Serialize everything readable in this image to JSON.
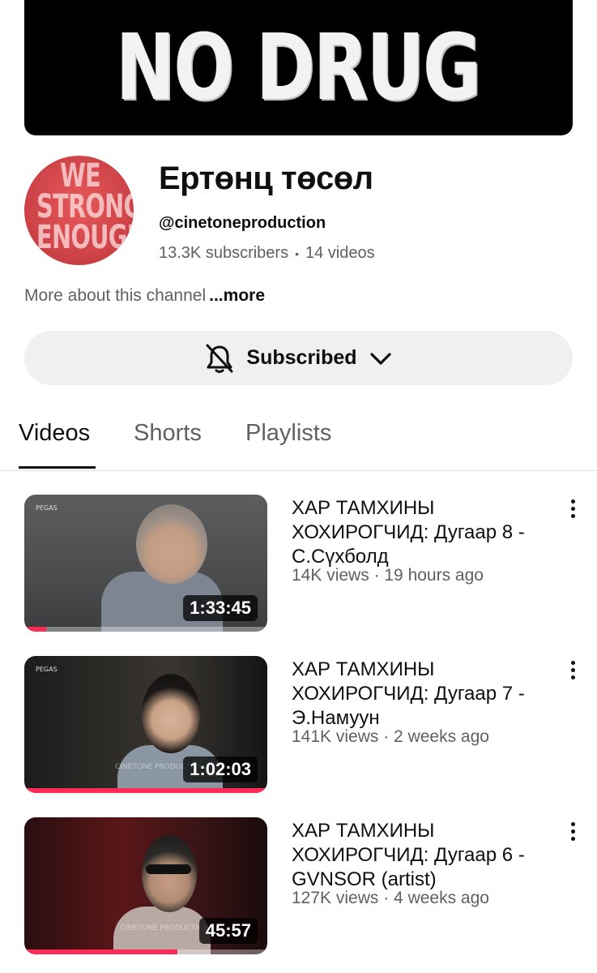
{
  "banner": {
    "text": "NO DRUG"
  },
  "channel": {
    "name": "Ертөнц төсөл",
    "handle": "@cinetoneproduction",
    "subscribers": "13.3K subscribers",
    "videos_count": "14 videos",
    "about": "More about this channel",
    "about_more": "...more",
    "avatar_text": [
      "WE",
      "STRONG",
      "ENOUGH"
    ]
  },
  "subscribe": {
    "label": "Subscribed"
  },
  "tabs": [
    {
      "label": "Videos",
      "active": true
    },
    {
      "label": "Shorts",
      "active": false
    },
    {
      "label": "Playlists",
      "active": false
    }
  ],
  "videos": [
    {
      "title": "ХАР ТАМХИНЫ ХОХИРОГЧИД: Дугаар 8 - С.Сүхболд",
      "meta": "14K views · 19 hours ago",
      "duration": "1:33:45",
      "watched_fraction": 0.09,
      "thumb_label": "PEGAS"
    },
    {
      "title": "ХАР ТАМХИНЫ ХОХИРОГЧИД: Дугаар 7 - Э.Намуун",
      "meta": "141K views · 2 weeks ago",
      "duration": "1:02:03",
      "watched_fraction": 1.0,
      "thumb_label": "PEGAS",
      "watermark": "CINETONE PRODUCTION"
    },
    {
      "title": "ХАР ТАМХИНЫ ХОХИРОГЧИД: Дугаар 6 - GVNSOR (artist)",
      "meta": "127K views · 4 weeks ago",
      "duration": "45:57",
      "watched_fraction": 0.63,
      "watermark": "CINETONE PRODUCTION"
    }
  ],
  "colors": {
    "progress": "#ff2a55",
    "avatar": "#d2474b",
    "banner": "#000000"
  }
}
